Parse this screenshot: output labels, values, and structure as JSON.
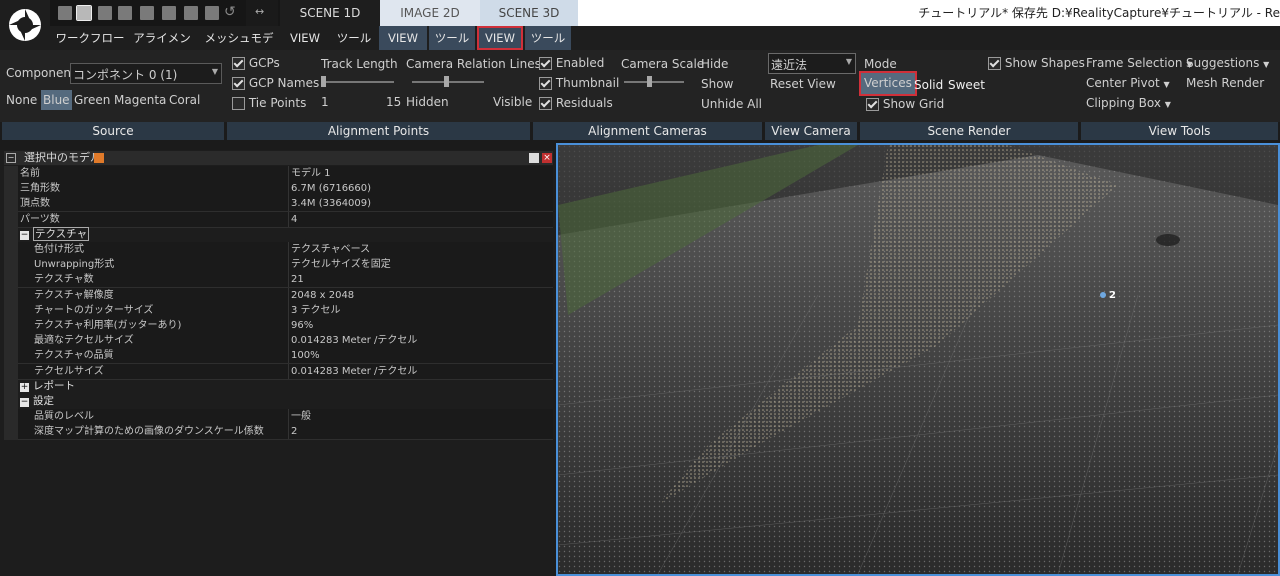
{
  "topbar": {
    "tabs": [
      "SCENE 1D",
      "IMAGE 2D",
      "SCENE 3D"
    ],
    "arrows": "↔",
    "title": "チュートリアル* 保存先 D:¥RealityCapture¥チュートリアル - Re"
  },
  "menu": {
    "items": [
      "ワークフロー",
      "アライメント",
      "メッシュモデル",
      "VIEW",
      "ツール",
      "VIEW",
      "ツール",
      "VIEW",
      "ツール"
    ]
  },
  "ribbon": {
    "source": {
      "component_label": "Component",
      "component_value": "コンポネント 0 (1)",
      "colors": [
        "None",
        "Blue",
        "Green",
        "Magenta",
        "Coral"
      ],
      "section": "Source"
    },
    "alignment_points": {
      "gcps": "GCPs",
      "gcp_names": "GCP Names",
      "tie_points": "Tie Points",
      "track_length": "Track Length",
      "track_min": "1",
      "track_max": "15",
      "camera_relation": "Camera Relation Lines",
      "hidden": "Hidden",
      "visible": "Visible",
      "section": "Alignment Points"
    },
    "alignment_cameras": {
      "enabled": "Enabled",
      "thumbnail": "Thumbnail",
      "residuals": "Residuals",
      "camera_scale": "Camera Scale",
      "hide": "Hide",
      "show": "Show",
      "unhide_all": "Unhide All",
      "section": "Alignment Cameras"
    },
    "view_camera": {
      "projection": "遠近法",
      "reset_view": "Reset View",
      "section": "View Camera"
    },
    "scene_render": {
      "mode": "Mode",
      "show_shapes": "Show Shapes",
      "vertices": "Vertices",
      "solid": "Solid",
      "sweet": "Sweet",
      "show_grid": "Show Grid",
      "section": "Scene Render"
    },
    "view_tools": {
      "frame_selection": "Frame Selection",
      "suggestions": "Suggestions",
      "center_pivot": "Center Pivot",
      "mesh_render": "Mesh Render",
      "clipping_box": "Clipping Box",
      "section": "View Tools"
    }
  },
  "panel": {
    "title": "選択中のモデル",
    "rows": [
      {
        "k": "名前",
        "v": "モデル 1"
      },
      {
        "k": "三角形数",
        "v": "6.7M (6716660)"
      },
      {
        "k": "頂点数",
        "v": "3.4M (3364009)"
      },
      {
        "k": "パーツ数",
        "v": "4"
      }
    ],
    "texture_group": "テクスチャ",
    "texture_rows": [
      {
        "k": "色付け形式",
        "v": "テクスチャベース"
      },
      {
        "k": "Unwrapping形式",
        "v": "テクセルサイズを固定"
      },
      {
        "k": "テクスチャ数",
        "v": "21"
      },
      {
        "k": "テクスチャ解像度",
        "v": "2048 x 2048"
      },
      {
        "k": "チャートのガッターサイズ",
        "v": "3 テクセル"
      },
      {
        "k": "テクスチャ利用率(ガッターあり)",
        "v": "96%"
      },
      {
        "k": "最適なテクセルサイズ",
        "v": "0.014283 Meter /テクセル"
      },
      {
        "k": "テクスチャの品質",
        "v": "100%"
      },
      {
        "k": "テクセルサイズ",
        "v": "0.014283 Meter /テクセル"
      }
    ],
    "report_group": "レポート",
    "settings_group": "設定",
    "settings_rows": [
      {
        "k": "品質のレベル",
        "v": "一般"
      },
      {
        "k": "深度マップ計算のための画像のダウンスケール係数",
        "v": "2"
      }
    ]
  },
  "viewport": {
    "marker_label": "2"
  }
}
